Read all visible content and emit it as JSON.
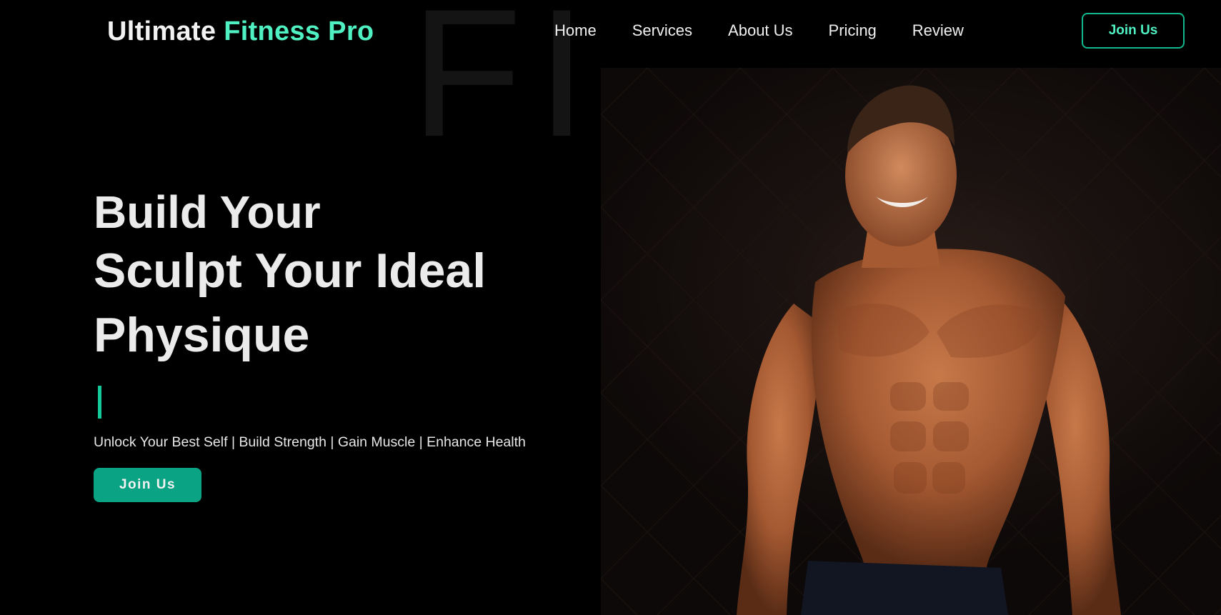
{
  "header": {
    "logo_primary": "Ultimate",
    "logo_accent": "Fitness Pro",
    "nav": [
      {
        "label": "Home"
      },
      {
        "label": "Services"
      },
      {
        "label": "About Us"
      },
      {
        "label": "Pricing"
      },
      {
        "label": "Review"
      }
    ],
    "cta_label": "Join Us"
  },
  "background_text": "FI",
  "hero": {
    "heading_line1": "Build Your",
    "heading_line2": "Sculpt Your Ideal",
    "heading_line3": "Physique",
    "tagline": "Unlock Your Best Self | Build Strength | Gain Muscle | Enhance Health",
    "cta_label": "Join Us",
    "image": "shirtless-muscular-man-photo"
  },
  "colors": {
    "background": "#000000",
    "accent": "#4ff0c2",
    "button": "#0aa383",
    "button_border": "#12b88d",
    "text": "#ebebeb"
  }
}
